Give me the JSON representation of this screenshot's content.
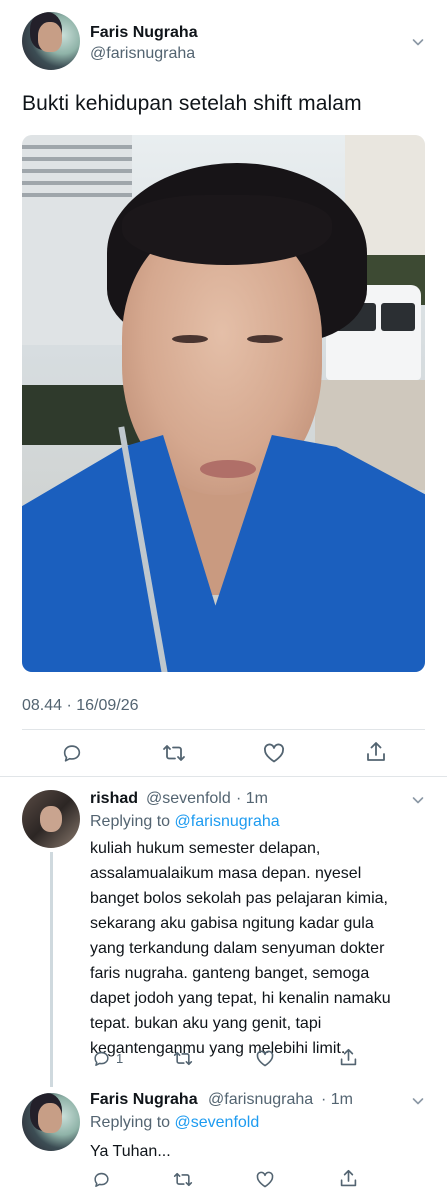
{
  "main_tweet": {
    "author_name": "Faris Nugraha",
    "author_handle": "@farisnugraha",
    "text": "Bukti kehidupan setelah shift malam",
    "timestamp": "08.44 · 16/09/26",
    "actions": [
      "reply-icon",
      "retweet-icon",
      "like-icon",
      "share-icon"
    ]
  },
  "replies": [
    {
      "author_name": "rishad",
      "author_handle": "@sevenfold",
      "time": "· 1m",
      "replying_prefix": "Replying to",
      "replying_to": "@farisnugraha",
      "lines": [
        "kuliah hukum semester delapan,",
        "assalamualaikum masa depan. nyesel",
        "banget bolos sekolah pas pelajaran kimia,",
        "sekarang aku gabisa ngitung kadar gula",
        "yang terkandung dalam senyuman dokter",
        "faris nugraha. ganteng banget, semoga",
        "dapet jodoh yang tepat, hi kenalin namaku",
        "tepat. bukan aku yang genit, tapi",
        "kegantenganmu yang melebihi limit."
      ],
      "reply_count": "1"
    },
    {
      "author_name": "Faris Nugraha",
      "author_handle": "@farisnugraha",
      "time": "· 1m",
      "replying_prefix": "Replying to",
      "replying_to": "@sevenfold",
      "lines": [
        "Ya Tuhan..."
      ],
      "reply_count": ""
    }
  ],
  "colors": {
    "text": "#0f1419",
    "secondary": "#536471",
    "link": "#1d9bf0",
    "divider": "#e1e5e8"
  }
}
